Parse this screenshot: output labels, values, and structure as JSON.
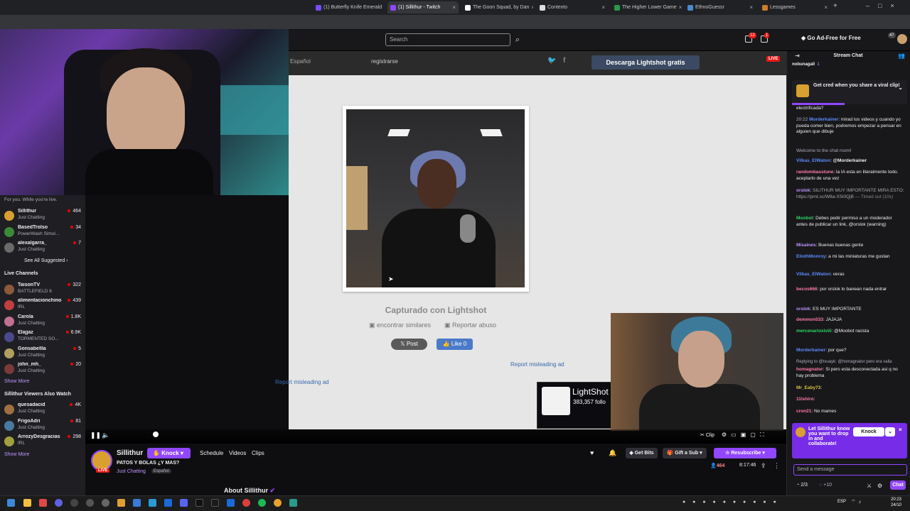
{
  "browser": {
    "tabs": [
      {
        "label": "(1) Butterfly Knife Emerald",
        "active": false
      },
      {
        "label": "(1) Sillithur - Twitch",
        "active": true
      },
      {
        "label": "The Goon Squad, by Dan",
        "active": false
      },
      {
        "label": "Contexto",
        "active": false
      },
      {
        "label": "The Higher Lower Game",
        "active": false
      },
      {
        "label": "EthnoGuessr",
        "active": false
      },
      {
        "label": "Lessgames",
        "active": false
      }
    ]
  },
  "topnav": {
    "search_placeholder": "Search",
    "notif_badge": "12",
    "inbox_badge": "1",
    "adfree_label": "Go Ad-Free for Free",
    "prime_badge": "47"
  },
  "sidebar": {
    "for_you_text": "For you. While you're live.",
    "suggested": [
      {
        "name": "Sillithur",
        "category": "Just Chatting",
        "viewers": "464",
        "color": "#d8a030"
      },
      {
        "name": "BasedTrolso",
        "category": "PowerWash Simul...",
        "viewers": "34",
        "color": "#3a8a3a"
      },
      {
        "name": "alexalgarra_",
        "category": "Just Chatting",
        "viewers": "7",
        "color": "#6a6a6a"
      }
    ],
    "see_all": "See All Suggested",
    "live_channels_title": "Live Channels",
    "live_channels": [
      {
        "name": "TaisonTV",
        "category": "BATTLEFIELD 6",
        "viewers": "322",
        "color": "#8a5a3a"
      },
      {
        "name": "alimentacionchino",
        "category": "IRL",
        "viewers": "439",
        "color": "#c04040"
      },
      {
        "name": "Carola",
        "category": "Just Chatting",
        "viewers": "1.8K",
        "color": "#c07090"
      },
      {
        "name": "Elajjaz",
        "category": "TORMENTED SO...",
        "viewers": "6.9K",
        "color": "#4a4a8a"
      },
      {
        "name": "Gonsabellla",
        "category": "Just Chatting",
        "viewers": "5",
        "color": "#b0a060"
      },
      {
        "name": "john_mh_",
        "category": "Just Chatting",
        "viewers": "20",
        "color": "#7a3a3a"
      }
    ],
    "show_more": "Show More",
    "also_watch_title": "Sillithur Viewers Also Watch",
    "also_watch": [
      {
        "name": "quesadacid",
        "category": "Just Chatting",
        "viewers": "4K",
        "color": "#a07040"
      },
      {
        "name": "FrigoAdri",
        "category": "Just Chatting",
        "viewers": "81",
        "color": "#4a7aa0"
      },
      {
        "name": "ArrozyDesgracias",
        "category": "IRL",
        "viewers": "298",
        "color": "#a0a040"
      }
    ],
    "show_more_2": "Show More"
  },
  "lightshot": {
    "language": "Español",
    "register": "registrarse",
    "download_btn": "Descarga Lightshot gratis",
    "live_badge": "LIVE",
    "caption": "Capturado con Lightshot",
    "find_similar": "encontrar similares",
    "report_abuse": "Reportar abuso",
    "x_post": "Post",
    "fb_like": "Like 0",
    "misleading_ad_1": "Report misleading ad",
    "misleading_ad_2": "Report misleading ad",
    "ad_title": "LightShot",
    "ad_followers": "383,357 follo"
  },
  "player": {
    "clip_label": "Clip"
  },
  "stream": {
    "channel": "Sillithur",
    "knock_label": "Knock",
    "nav": [
      "Schedule",
      "Videos",
      "Clips"
    ],
    "title": "PATOS Y BOLAS ¿Y MAS?",
    "category": "Just Chatting",
    "tag": "Español",
    "live_badge": "LIVE",
    "get_bits": "Get Bits",
    "gift_sub": "Gift a Sub",
    "resubscribe": "Resubscribe",
    "viewers": "464",
    "uptime": "8:17:46",
    "about": "About Sillithur"
  },
  "chat": {
    "title": "Stream Chat",
    "gifter": "nobunagaII",
    "gift_count": "1",
    "cred_text": "Get cred when you share a viral clip!",
    "messages": [
      {
        "user": "",
        "text": "electrificada?",
        "color": "#efeff1"
      },
      {
        "user": "Morderkainer",
        "text": "mirad los videos y cuando yo pueda comer bien, podremos empezar a pensar en alguien que dibuje",
        "color": "#5c8aff",
        "time": "20:22"
      },
      {
        "user": "",
        "text": "Welcome to the chat room!",
        "color": "#adadb8"
      },
      {
        "user": "Vilkas_ElWaton",
        "text": "@Morderkainer",
        "color": "#5c8aff"
      },
      {
        "user": "randombasstune",
        "text": "la IA esta en literalmente todo. aceptarlo de una vez",
        "color": "#ff7aa8"
      },
      {
        "user": "orslok",
        "text": "SILITHUR MUY IMPORTANTE MIRA ESTO: https://prnt.sc/W8a-XSi0QjB",
        "color": "#bf94ff"
      },
      {
        "user": "",
        "text": "— Timed out (10s)",
        "color": "#adadb8"
      },
      {
        "user": "Moobot",
        "text": "Debes pedir permiso a un moderador antes de publicar un link, @orslok (warning)",
        "color": "#2bd964"
      },
      {
        "user": "Misaines",
        "text": "Buenas buenas gente",
        "color": "#bf94ff"
      },
      {
        "user": "EliothMonroy",
        "text": "a mi las miniaturas me gustan",
        "color": "#5c8aff"
      },
      {
        "user": "Vilkas_ElWaton",
        "text": "veras",
        "color": "#5c8aff"
      },
      {
        "user": "becos666",
        "text": "por orslok lo banean nada entrar",
        "color": "#ff7aa8"
      },
      {
        "user": "orslok",
        "text": "ES MUY IMPORTANTE",
        "color": "#bf94ff"
      },
      {
        "user": "demmon533",
        "text": "JAJAJA",
        "color": "#ff7aa8"
      },
      {
        "user": "mercenarioxiviii",
        "text": "@Moobot racista",
        "color": "#2bd964"
      },
      {
        "user": "Morderkainer",
        "text": "por que?",
        "color": "#5c8aff"
      },
      {
        "user": "",
        "text": "Replying to @txuayk: @homagnator pero era valla",
        "color": "#adadb8"
      },
      {
        "user": "homagnator",
        "text": "Si pero esta desconectada asi q no hay problema",
        "color": "#ff7aa8"
      },
      {
        "user": "Mr_Eaby73",
        "text": "",
        "color": "#d8c040"
      },
      {
        "user": "11lshiro",
        "text": "",
        "color": "#ff7aa8"
      },
      {
        "user": "cron21",
        "text": "No mames",
        "color": "#ff7aa8"
      }
    ],
    "knock_panel_text": "Let Sillithur know you want to drop in and collaborate!",
    "knock_btn": "Knock",
    "input_placeholder": "Send a message",
    "points": "2/3",
    "points_bonus": "+10",
    "chat_btn": "Chat"
  },
  "taskbar": {
    "lang": "ESP",
    "time": "20:23",
    "date": "24/10"
  }
}
